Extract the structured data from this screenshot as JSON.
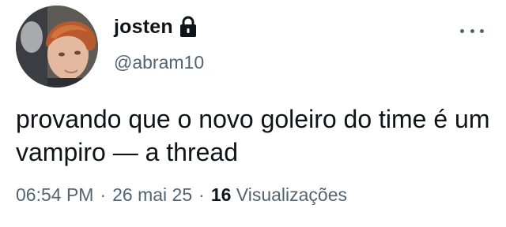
{
  "tweet": {
    "display_name": "josten",
    "handle": "@abram10",
    "text": "provando que o novo goleiro do time é um vampiro — a thread",
    "time": "06:54 PM",
    "separator": "·",
    "date": "26 mai 25",
    "views_count": "16",
    "views_label": "Visualizações",
    "protected_icon": "lock-icon",
    "more_icon": "more-horizontal-icon"
  },
  "colors": {
    "text_primary": "#0f1419",
    "text_secondary": "#536471",
    "background": "#ffffff"
  }
}
